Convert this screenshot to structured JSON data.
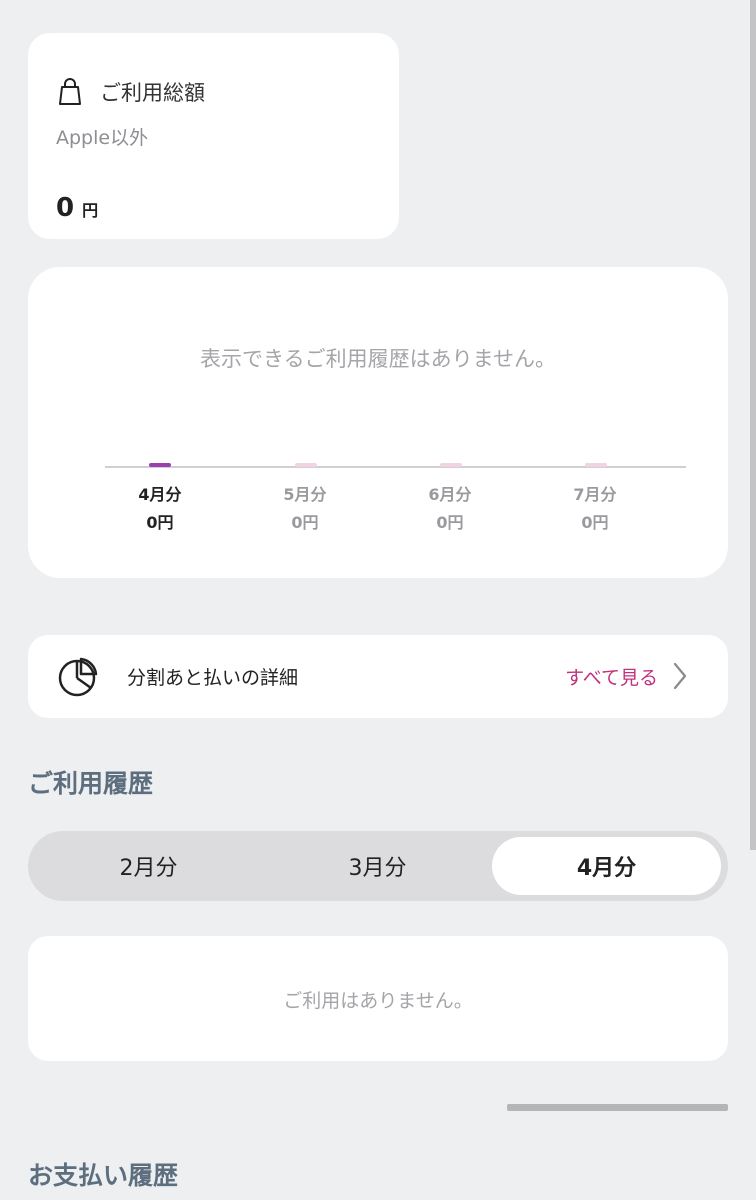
{
  "summary": {
    "icon": "shopping-bag-icon",
    "title": "ご利用総額",
    "subtitle": "Apple以外",
    "amount": "0",
    "unit": "円"
  },
  "usage_chart": {
    "empty_message": "表示できるご利用履歴はありません。",
    "months": [
      {
        "label": "4月分",
        "amount": "0円",
        "active": true
      },
      {
        "label": "5月分",
        "amount": "0円",
        "active": false
      },
      {
        "label": "6月分",
        "amount": "0円",
        "active": false
      },
      {
        "label": "7月分",
        "amount": "0円",
        "active": false
      }
    ],
    "colors": {
      "active": "#9b3fb0",
      "inactive": "#f2d3e2",
      "baseline": "#cfcfd4"
    }
  },
  "installment": {
    "icon": "pie-chart-icon",
    "label": "分割あと払いの詳細",
    "see_all": "すべて見る",
    "chevron_icon": "chevron-right-icon",
    "accent_color": "#c2317d"
  },
  "history": {
    "title": "ご利用履歴",
    "tabs": [
      {
        "label": "2月分",
        "active": false
      },
      {
        "label": "3月分",
        "active": false
      },
      {
        "label": "4月分",
        "active": true
      }
    ],
    "empty_message": "ご利用はありません。"
  },
  "payment": {
    "title": "お支払い履歴"
  }
}
